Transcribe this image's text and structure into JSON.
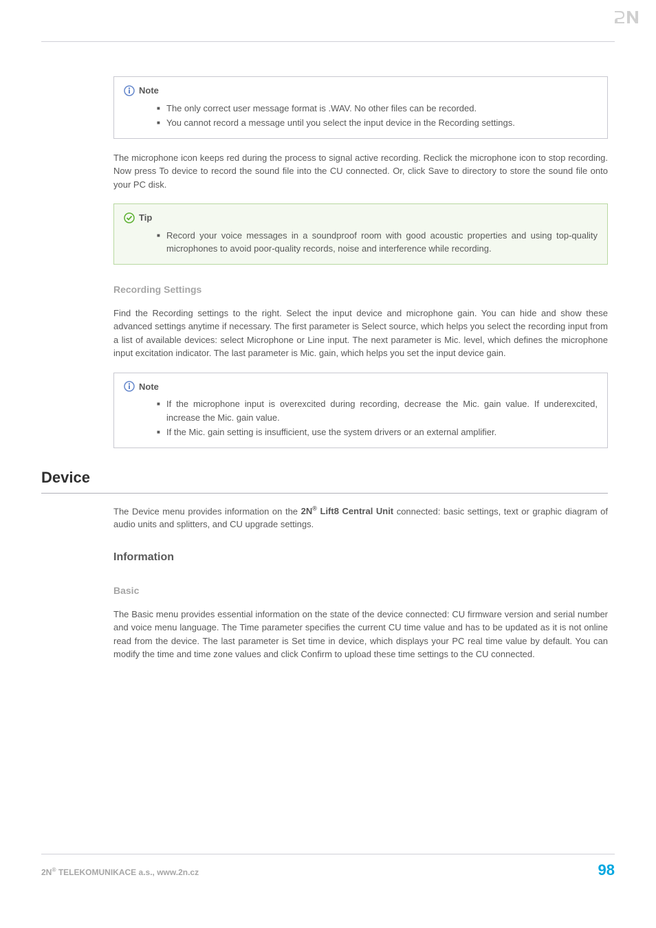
{
  "logo_text": "2N",
  "callout_note1": {
    "title": "Note",
    "items": [
      "The only correct user message format is .WAV. No other files can be recorded.",
      "You cannot record a message until you select the input device in the Recording settings."
    ]
  },
  "para1": "The microphone icon keeps red during the process to signal active recording. Reclick the microphone icon to stop recording. Now press To device to record the sound file into the CU connected. Or, click Save to directory to store the sound file onto your PC disk.",
  "callout_tip1": {
    "title": "Tip",
    "items": [
      "Record your voice messages in a soundproof room with good acoustic properties and using top-quality microphones to avoid poor-quality records, noise and interference while recording."
    ]
  },
  "h4_recording": "Recording Settings",
  "para2": "Find the Recording settings to the right. Select the input device and microphone gain. You can hide and show these advanced settings anytime if necessary. The first parameter is Select source, which helps you select the recording input from a list of available devices: select Microphone or Line input. The next parameter is Mic. level, which defines the microphone input excitation indicator. The last parameter is Mic. gain, which helps you set the input device gain.",
  "callout_note2": {
    "title": "Note",
    "items": [
      "If the microphone input is overexcited during recording, decrease the Mic. gain value. If underexcited, increase the Mic. gain value.",
      "If the Mic. gain setting is insufficient, use the system drivers or an external amplifier."
    ]
  },
  "h2_device": "Device",
  "para3_pre": "The Device menu provides information on the ",
  "para3_bold": "2N® Lift8 Central Unit",
  "para3_post": " connected: basic settings, text or graphic diagram of audio units and splitters, and CU upgrade settings.",
  "h3_information": "Information",
  "h4_basic": "Basic",
  "para4": "The Basic menu provides essential information on the state of the device connected: CU firmware version and serial number and voice menu language. The Time parameter specifies the current CU time value and has to be updated as it is not online read from the device. The last parameter is Set time in device, which displays your PC real time value by default. You can modify the time and time zone values and click Confirm to upload these time settings to the CU connected.",
  "footer": {
    "company_pre": "2N",
    "company_post": " TELEKOMUNIKACE a.s., www.2n.cz",
    "page_number": "98"
  }
}
